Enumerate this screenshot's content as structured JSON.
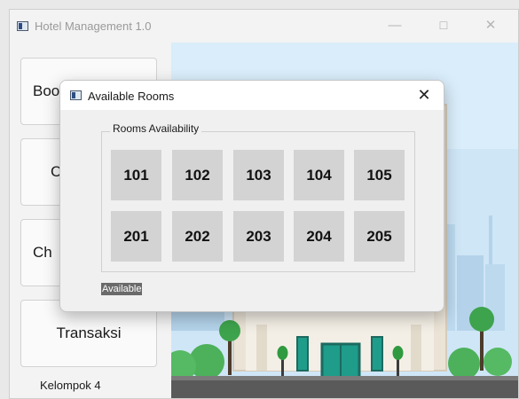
{
  "window": {
    "title": "Hotel Management 1.0",
    "minimize_glyph": "—",
    "maximize_glyph": "☐",
    "close_glyph": "✕"
  },
  "sidebar": {
    "items": [
      {
        "label": "Boo"
      },
      {
        "label": "C"
      },
      {
        "label": "Ch"
      },
      {
        "label": "Transaksi"
      }
    ],
    "footer": "Kelompok 4"
  },
  "dialog": {
    "title": "Available Rooms",
    "close_glyph": "✕",
    "group_label": "Rooms Availability",
    "rooms": [
      {
        "number": "101"
      },
      {
        "number": "102"
      },
      {
        "number": "103"
      },
      {
        "number": "104"
      },
      {
        "number": "105"
      },
      {
        "number": "201"
      },
      {
        "number": "202"
      },
      {
        "number": "203"
      },
      {
        "number": "204"
      },
      {
        "number": "205"
      }
    ],
    "legend": "Available"
  },
  "colors": {
    "room_available": "#d3d3d3",
    "legend_bg": "#6a6a6a",
    "sky": "#cfe6f7"
  }
}
